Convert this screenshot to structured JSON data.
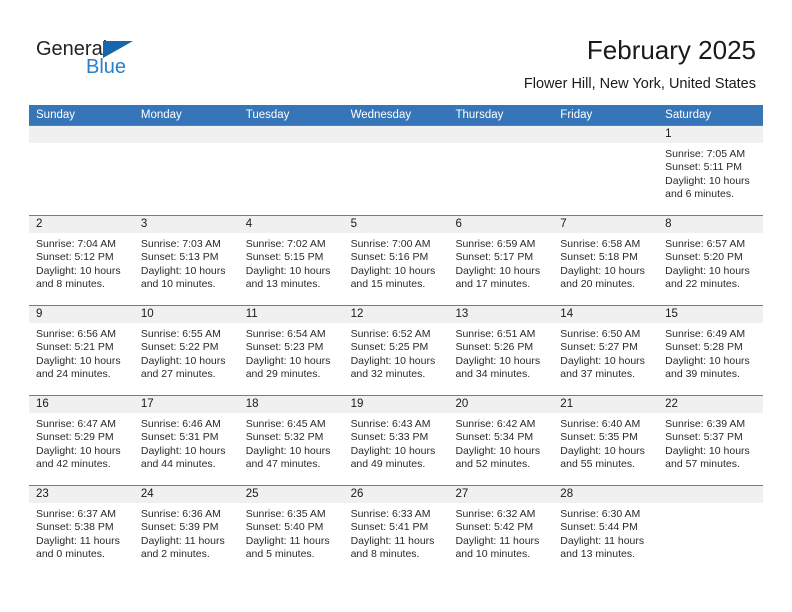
{
  "brand": {
    "name_part1": "General",
    "name_part2": "Blue",
    "color_dark": "#232323",
    "color_blue": "#2a7fc9",
    "triangle_color": "#1667ae"
  },
  "header": {
    "title": "February 2025",
    "location": "Flower Hill, New York, United States",
    "accent_color": "#3575b8",
    "band_color": "#f0f0f0"
  },
  "weekdays": [
    "Sunday",
    "Monday",
    "Tuesday",
    "Wednesday",
    "Thursday",
    "Friday",
    "Saturday"
  ],
  "weeks": [
    [
      {
        "empty": true
      },
      {
        "empty": true
      },
      {
        "empty": true
      },
      {
        "empty": true
      },
      {
        "empty": true
      },
      {
        "empty": true
      },
      {
        "day": "1",
        "sunrise": "Sunrise: 7:05 AM",
        "sunset": "Sunset: 5:11 PM",
        "daylight1": "Daylight: 10 hours",
        "daylight2": "and 6 minutes."
      }
    ],
    [
      {
        "day": "2",
        "sunrise": "Sunrise: 7:04 AM",
        "sunset": "Sunset: 5:12 PM",
        "daylight1": "Daylight: 10 hours",
        "daylight2": "and 8 minutes."
      },
      {
        "day": "3",
        "sunrise": "Sunrise: 7:03 AM",
        "sunset": "Sunset: 5:13 PM",
        "daylight1": "Daylight: 10 hours",
        "daylight2": "and 10 minutes."
      },
      {
        "day": "4",
        "sunrise": "Sunrise: 7:02 AM",
        "sunset": "Sunset: 5:15 PM",
        "daylight1": "Daylight: 10 hours",
        "daylight2": "and 13 minutes."
      },
      {
        "day": "5",
        "sunrise": "Sunrise: 7:00 AM",
        "sunset": "Sunset: 5:16 PM",
        "daylight1": "Daylight: 10 hours",
        "daylight2": "and 15 minutes."
      },
      {
        "day": "6",
        "sunrise": "Sunrise: 6:59 AM",
        "sunset": "Sunset: 5:17 PM",
        "daylight1": "Daylight: 10 hours",
        "daylight2": "and 17 minutes."
      },
      {
        "day": "7",
        "sunrise": "Sunrise: 6:58 AM",
        "sunset": "Sunset: 5:18 PM",
        "daylight1": "Daylight: 10 hours",
        "daylight2": "and 20 minutes."
      },
      {
        "day": "8",
        "sunrise": "Sunrise: 6:57 AM",
        "sunset": "Sunset: 5:20 PM",
        "daylight1": "Daylight: 10 hours",
        "daylight2": "and 22 minutes."
      }
    ],
    [
      {
        "day": "9",
        "sunrise": "Sunrise: 6:56 AM",
        "sunset": "Sunset: 5:21 PM",
        "daylight1": "Daylight: 10 hours",
        "daylight2": "and 24 minutes."
      },
      {
        "day": "10",
        "sunrise": "Sunrise: 6:55 AM",
        "sunset": "Sunset: 5:22 PM",
        "daylight1": "Daylight: 10 hours",
        "daylight2": "and 27 minutes."
      },
      {
        "day": "11",
        "sunrise": "Sunrise: 6:54 AM",
        "sunset": "Sunset: 5:23 PM",
        "daylight1": "Daylight: 10 hours",
        "daylight2": "and 29 minutes."
      },
      {
        "day": "12",
        "sunrise": "Sunrise: 6:52 AM",
        "sunset": "Sunset: 5:25 PM",
        "daylight1": "Daylight: 10 hours",
        "daylight2": "and 32 minutes."
      },
      {
        "day": "13",
        "sunrise": "Sunrise: 6:51 AM",
        "sunset": "Sunset: 5:26 PM",
        "daylight1": "Daylight: 10 hours",
        "daylight2": "and 34 minutes."
      },
      {
        "day": "14",
        "sunrise": "Sunrise: 6:50 AM",
        "sunset": "Sunset: 5:27 PM",
        "daylight1": "Daylight: 10 hours",
        "daylight2": "and 37 minutes."
      },
      {
        "day": "15",
        "sunrise": "Sunrise: 6:49 AM",
        "sunset": "Sunset: 5:28 PM",
        "daylight1": "Daylight: 10 hours",
        "daylight2": "and 39 minutes."
      }
    ],
    [
      {
        "day": "16",
        "sunrise": "Sunrise: 6:47 AM",
        "sunset": "Sunset: 5:29 PM",
        "daylight1": "Daylight: 10 hours",
        "daylight2": "and 42 minutes."
      },
      {
        "day": "17",
        "sunrise": "Sunrise: 6:46 AM",
        "sunset": "Sunset: 5:31 PM",
        "daylight1": "Daylight: 10 hours",
        "daylight2": "and 44 minutes."
      },
      {
        "day": "18",
        "sunrise": "Sunrise: 6:45 AM",
        "sunset": "Sunset: 5:32 PM",
        "daylight1": "Daylight: 10 hours",
        "daylight2": "and 47 minutes."
      },
      {
        "day": "19",
        "sunrise": "Sunrise: 6:43 AM",
        "sunset": "Sunset: 5:33 PM",
        "daylight1": "Daylight: 10 hours",
        "daylight2": "and 49 minutes."
      },
      {
        "day": "20",
        "sunrise": "Sunrise: 6:42 AM",
        "sunset": "Sunset: 5:34 PM",
        "daylight1": "Daylight: 10 hours",
        "daylight2": "and 52 minutes."
      },
      {
        "day": "21",
        "sunrise": "Sunrise: 6:40 AM",
        "sunset": "Sunset: 5:35 PM",
        "daylight1": "Daylight: 10 hours",
        "daylight2": "and 55 minutes."
      },
      {
        "day": "22",
        "sunrise": "Sunrise: 6:39 AM",
        "sunset": "Sunset: 5:37 PM",
        "daylight1": "Daylight: 10 hours",
        "daylight2": "and 57 minutes."
      }
    ],
    [
      {
        "day": "23",
        "sunrise": "Sunrise: 6:37 AM",
        "sunset": "Sunset: 5:38 PM",
        "daylight1": "Daylight: 11 hours",
        "daylight2": "and 0 minutes."
      },
      {
        "day": "24",
        "sunrise": "Sunrise: 6:36 AM",
        "sunset": "Sunset: 5:39 PM",
        "daylight1": "Daylight: 11 hours",
        "daylight2": "and 2 minutes."
      },
      {
        "day": "25",
        "sunrise": "Sunrise: 6:35 AM",
        "sunset": "Sunset: 5:40 PM",
        "daylight1": "Daylight: 11 hours",
        "daylight2": "and 5 minutes."
      },
      {
        "day": "26",
        "sunrise": "Sunrise: 6:33 AM",
        "sunset": "Sunset: 5:41 PM",
        "daylight1": "Daylight: 11 hours",
        "daylight2": "and 8 minutes."
      },
      {
        "day": "27",
        "sunrise": "Sunrise: 6:32 AM",
        "sunset": "Sunset: 5:42 PM",
        "daylight1": "Daylight: 11 hours",
        "daylight2": "and 10 minutes."
      },
      {
        "day": "28",
        "sunrise": "Sunrise: 6:30 AM",
        "sunset": "Sunset: 5:44 PM",
        "daylight1": "Daylight: 11 hours",
        "daylight2": "and 13 minutes."
      },
      {
        "empty": true
      }
    ]
  ]
}
